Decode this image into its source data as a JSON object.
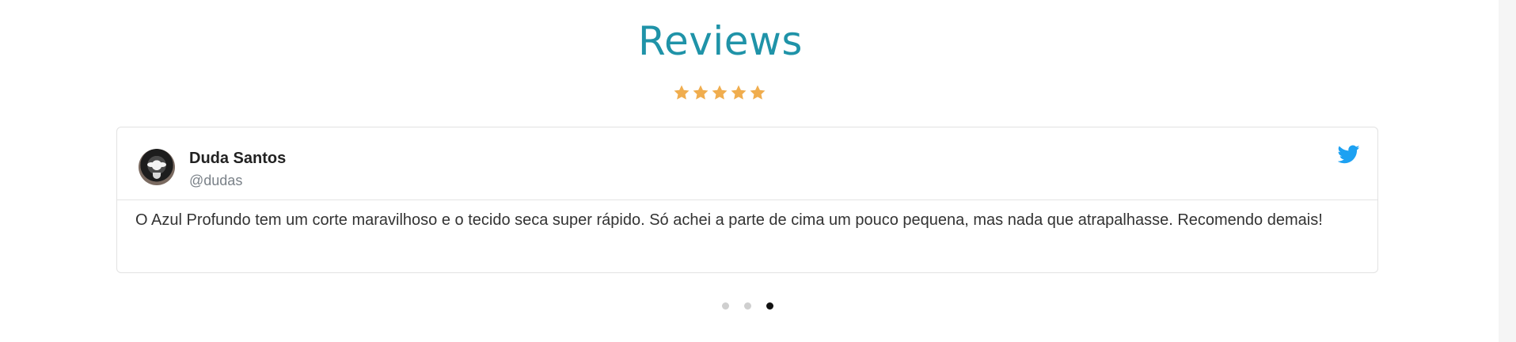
{
  "section": {
    "title": "Reviews",
    "rating": 5
  },
  "review": {
    "author_name": "Duda Santos",
    "author_handle": "@dudas",
    "source_icon": "twitter-icon",
    "text": "O Azul Profundo tem um corte maravilhoso e o tecido seca super rápido. Só achei a parte de cima um pouco pequena, mas nada que atrapalhasse. Recomendo demais!"
  },
  "carousel": {
    "total": 3,
    "active_index": 3
  },
  "colors": {
    "title": "#1f93a8",
    "star": "#f0ad4e",
    "twitter": "#1da1f2",
    "active_dot": "#111111",
    "inactive_dot": "#cfcfcf"
  }
}
